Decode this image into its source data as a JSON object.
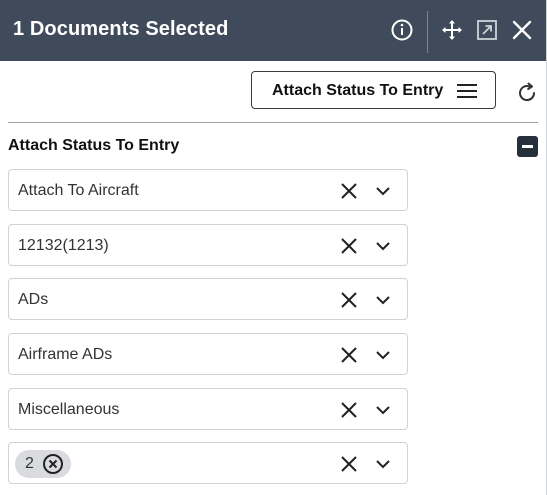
{
  "header": {
    "title": "1 Documents Selected",
    "icons": [
      "info-icon",
      "move-icon",
      "expand-icon",
      "close-icon"
    ]
  },
  "toolbar": {
    "button_label": "Attach Status To Entry",
    "button_icon": "menu-icon",
    "refresh_icon": "refresh-icon"
  },
  "section": {
    "title": "Attach Status To Entry",
    "collapse_icon": "collapse-icon"
  },
  "fields": [
    {
      "value": "Attach To Aircraft"
    },
    {
      "value": "12132(1213)"
    },
    {
      "value": "ADs"
    },
    {
      "value": "Airframe ADs"
    },
    {
      "value": "Miscellaneous"
    },
    {
      "chip": "2"
    }
  ],
  "colors": {
    "header_bg": "#3f4a5a",
    "collapse_bg": "#26303c",
    "chip_bg": "#d9dbde"
  }
}
